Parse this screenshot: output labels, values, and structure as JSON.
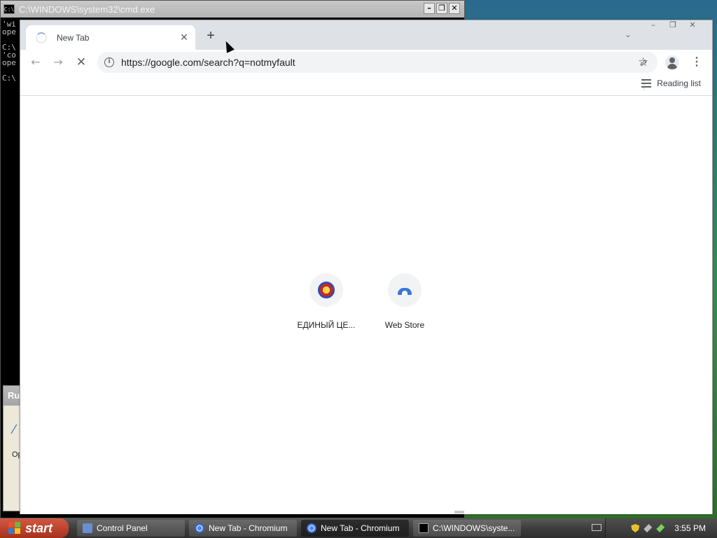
{
  "cmd": {
    "title": "C:\\WINDOWS\\system32\\cmd.exe",
    "icon_text": "C:\\",
    "lines": "'wi\nope\n\nC:\\\n'co\nope\n\nC:\\"
  },
  "run_dialog": {
    "title": "Ru",
    "label": "Op"
  },
  "browser": {
    "tab_title": "New Tab",
    "url": "https://google.com/search?q=notmyfault",
    "reading_list": "Reading list",
    "shortcuts": [
      {
        "label": "ЕДИНЫЙ ЦЕ..."
      },
      {
        "label": "Web Store"
      }
    ]
  },
  "taskbar": {
    "start_label": "start",
    "tasks": [
      {
        "label": "Control Panel",
        "active": false
      },
      {
        "label": "New Tab - Chromium",
        "active": false
      },
      {
        "label": "New Tab - Chromium",
        "active": true
      },
      {
        "label": "C:\\WINDOWS\\syste...",
        "active": false
      }
    ],
    "clock": "3:55 PM"
  }
}
